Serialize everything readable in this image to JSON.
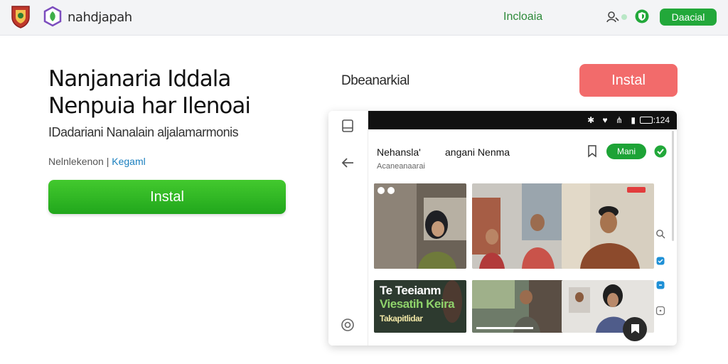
{
  "header": {
    "brand_name": "nahdjapah",
    "nav_link": "Incloaia",
    "top_button": "Daacial",
    "icons": [
      "crest-logo",
      "app-logo-icon",
      "user-search-icon",
      "shield-icon"
    ]
  },
  "hero": {
    "headline_line1": "Nanjanaria Iddala",
    "headline_line2": "Nenpuia har Ilenoai",
    "subline": "IDadariani Nanalain aljalamarmonis",
    "meta_text": "Nelnlekenon |",
    "meta_link": "Kegaml",
    "install_label": "Instal"
  },
  "preview": {
    "title": "Dbeanarkial",
    "install_label": "Instal",
    "status_time": ":124",
    "screen": {
      "title_a": "Nehansla'",
      "title_b": "angani Nenma",
      "subtitle": "Acaneanaarai",
      "follow_button": "Mani",
      "captions": {
        "thumb4_line1": "Te Teeianm",
        "thumb4_line2": "Viesatih Keira",
        "thumb4_line3": "Takapitlidar"
      }
    }
  },
  "colors": {
    "accent_green": "#22a83a",
    "install_alt_red": "#f26b6b",
    "link_blue": "#1a7fbf"
  }
}
